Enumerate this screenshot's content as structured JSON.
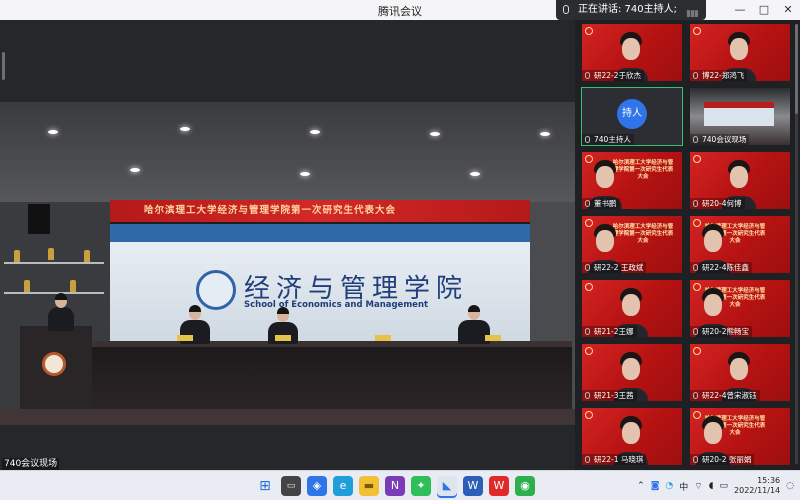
{
  "window": {
    "title": "腾讯会议",
    "controls": [
      "—",
      "□",
      "✕"
    ]
  },
  "speaking": {
    "label": "正在讲话: 740主持人;"
  },
  "main_video": {
    "label": "740会议现场",
    "banner_text": "哈尔滨理工大学经济与管理学院第一次研究生代表大会",
    "school_cn": "经济与管理学院",
    "school_en": "School of Economics and Management"
  },
  "gallery": {
    "tiles": [
      {
        "label": "研22-2于欣杰",
        "type": "person"
      },
      {
        "label": "博22-郑鸿飞",
        "type": "person"
      },
      {
        "label": "740主持人",
        "type": "avatar",
        "avatar_text": "持人"
      },
      {
        "label": "740会议现场",
        "type": "room"
      },
      {
        "label": "董书鹏",
        "type": "banner"
      },
      {
        "label": "研20-4何博",
        "type": "person"
      },
      {
        "label": "研22-2 王政斌",
        "type": "banner"
      },
      {
        "label": "研22-4陈佳鑫",
        "type": "banner"
      },
      {
        "label": "研21-2王娜",
        "type": "person"
      },
      {
        "label": "研20-2熊畅宝",
        "type": "banner"
      },
      {
        "label": "研21-3王茜",
        "type": "person"
      },
      {
        "label": "研22-4曾宋淑钰",
        "type": "person"
      },
      {
        "label": "研22-1 马晓琪",
        "type": "person"
      },
      {
        "label": "研20-2 张丽娟",
        "type": "banner"
      }
    ],
    "tile_banner": "哈尔滨理工大学经济与管理学院第一次研究生代表大会"
  },
  "taskbar": {
    "apps": [
      "windows-logo",
      "search",
      "files",
      "edge",
      "folder",
      "onenote",
      "wechat-alt",
      "tencent-meeting",
      "word",
      "wps",
      "chrome"
    ],
    "tray": {
      "ime": "中",
      "time": "15:36",
      "date": "2022/11/14"
    }
  },
  "colors": {
    "red_banner": "#c21b1b",
    "accent_blue": "#2f74e8",
    "selected_green": "#39c06d"
  }
}
